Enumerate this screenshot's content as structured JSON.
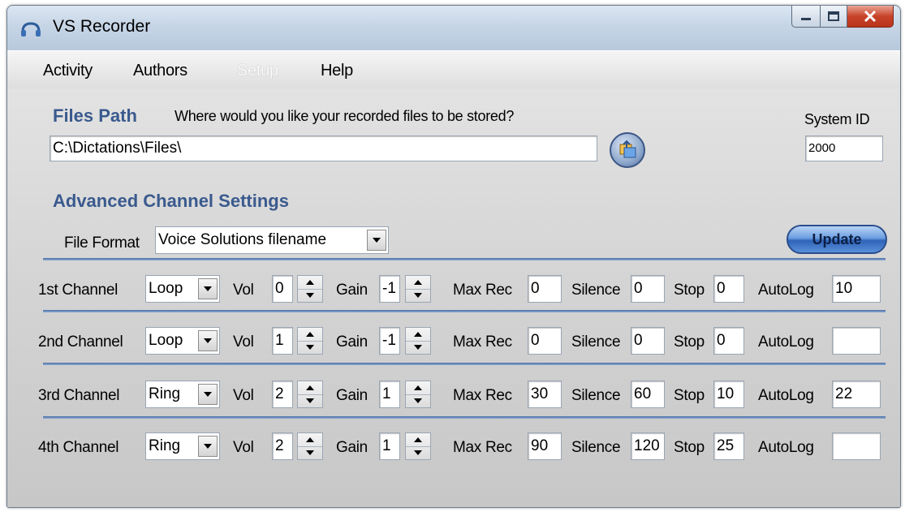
{
  "window": {
    "title": "VS Recorder"
  },
  "menu": [
    {
      "label": "Activity",
      "enabled": true
    },
    {
      "label": "Authors",
      "enabled": true
    },
    {
      "label": "Setup",
      "enabled": false
    },
    {
      "label": "Help",
      "enabled": true
    }
  ],
  "files_path": {
    "heading": "Files Path",
    "prompt": "Where would you like your recorded files to be stored?",
    "value": "C:\\Dictations\\Files\\"
  },
  "system_id": {
    "label": "System ID",
    "value": "2000"
  },
  "advanced": {
    "heading": "Advanced Channel Settings",
    "file_format_label": "File Format",
    "file_format_value": "Voice Solutions filename",
    "update_label": "Update"
  },
  "field_labels": {
    "vol": "Vol",
    "gain": "Gain",
    "max_rec": "Max Rec",
    "silence": "Silence",
    "stop": "Stop",
    "autolog": "AutoLog"
  },
  "channels": [
    {
      "name": "1st Channel",
      "mode": "Loop",
      "vol": "0",
      "gain": "-1",
      "max_rec": "0",
      "silence": "0",
      "stop": "0",
      "autolog": "10"
    },
    {
      "name": "2nd Channel",
      "mode": "Loop",
      "vol": "1",
      "gain": "-1",
      "max_rec": "0",
      "silence": "0",
      "stop": "0",
      "autolog": ""
    },
    {
      "name": "3rd Channel",
      "mode": "Ring",
      "vol": "2",
      "gain": "1",
      "max_rec": "30",
      "silence": "60",
      "stop": "10",
      "autolog": "22"
    },
    {
      "name": "4th Channel",
      "mode": "Ring",
      "vol": "2",
      "gain": "1",
      "max_rec": "90",
      "silence": "120",
      "stop": "25",
      "autolog": ""
    }
  ]
}
